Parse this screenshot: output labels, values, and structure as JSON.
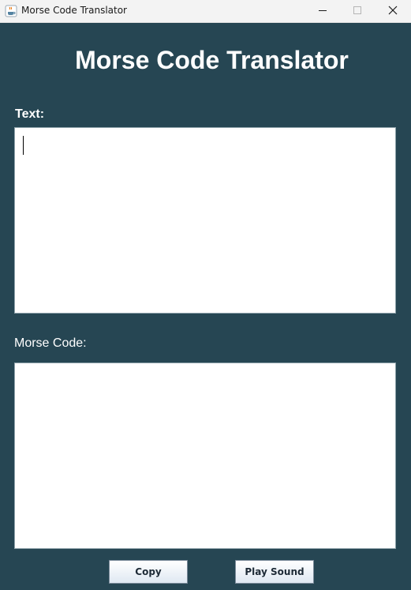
{
  "window": {
    "title": "Morse Code Translator",
    "icon": "java-cup-icon",
    "controls": [
      "minimize-icon",
      "maximize-icon",
      "close-icon"
    ]
  },
  "main": {
    "heading": "Morse Code Translator",
    "text_label": "Text:",
    "text_value": "",
    "morse_label": "Morse Code:",
    "morse_value": ""
  },
  "buttons": {
    "copy": "Copy",
    "play_sound": "Play Sound"
  },
  "colors": {
    "background": "#264653",
    "heading": "#ffffff",
    "textbox": "#ffffff"
  }
}
